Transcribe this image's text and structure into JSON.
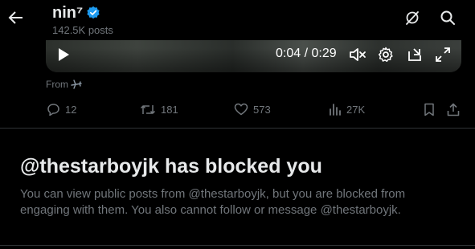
{
  "header": {
    "back_icon": "arrow-left-icon",
    "name": "nin⁷",
    "verified_icon": "verified-badge-icon",
    "post_count": "142.5K posts",
    "grok_icon": "grok-icon",
    "search_icon": "search-icon"
  },
  "video": {
    "time": "0:04 / 0:29",
    "icons": [
      "play-icon",
      "mute-icon",
      "gear-icon",
      "dock-icon",
      "fullscreen-icon"
    ]
  },
  "post": {
    "from_label": "From",
    "from_icon": "airplane-icon"
  },
  "actions": {
    "reply_count": "12",
    "repost_count": "181",
    "like_count": "573",
    "views_count": "27K"
  },
  "blocked": {
    "title": "@thestarboyjk has blocked you",
    "description": "You can view public posts from @thestarboyjk, but you are blocked from engaging with them. You also cannot follow or message @thestarboyjk."
  },
  "colors": {
    "background": "#000000",
    "primary_text": "#e7e9ea",
    "secondary_text": "#71767b",
    "verified": "#1d9bf0",
    "divider": "#2f3336"
  }
}
